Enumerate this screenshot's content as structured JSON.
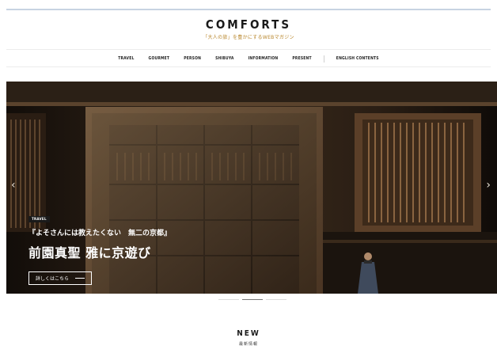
{
  "site": {
    "logo": "COMFORTS",
    "tagline": "「大人の旅」を豊かにするWEBマガジン"
  },
  "nav": {
    "items": [
      "TRAVEL",
      "GOURMET",
      "PERSON",
      "SHIBUYA",
      "INFORMATION",
      "PRESENT"
    ],
    "english": "ENGLISH CONTENTS"
  },
  "hero": {
    "category": "TRAVEL",
    "subtitle": "『よそさんには教えたくない　無二の京都』",
    "title": "前園真聖 雅に京遊び",
    "button": "詳しくはこちら",
    "prev_icon": "chevron-left-icon",
    "next_icon": "chevron-right-icon",
    "slides_total": 3,
    "active_slide": 2
  },
  "section": {
    "title": "NEW",
    "subtitle": "最新情報"
  },
  "colors": {
    "accent": "#b8862b",
    "top_rule": "#c7d3e2"
  }
}
